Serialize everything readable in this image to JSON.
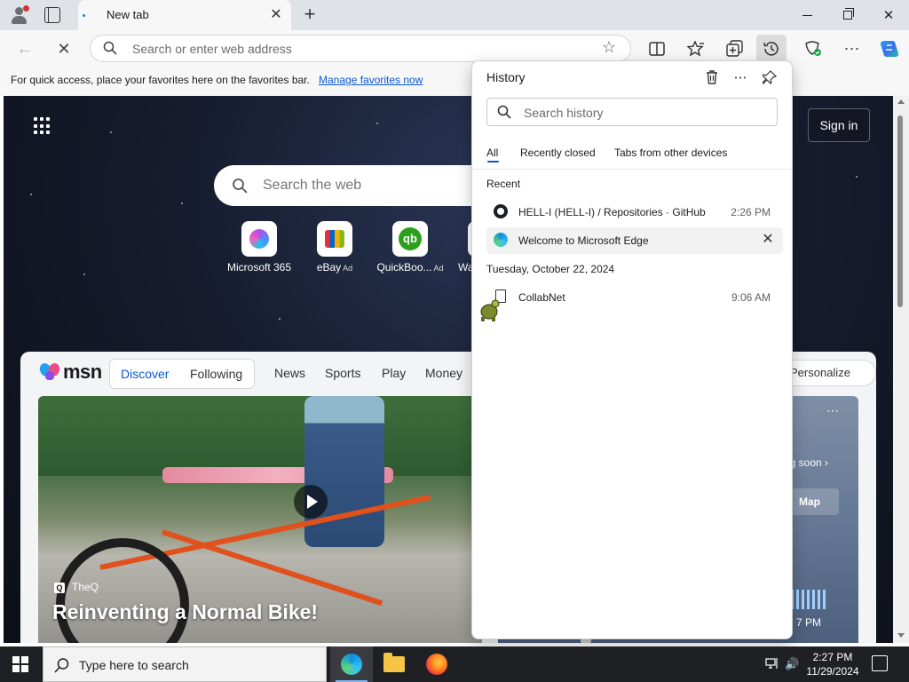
{
  "browser": {
    "tab": {
      "title": "New tab"
    },
    "address_bar": {
      "placeholder": "Search or enter web address"
    },
    "favorites_bar": {
      "message": "For quick access, place your favorites here on the favorites bar.",
      "link": "Manage favorites now"
    }
  },
  "page": {
    "sign_in": "Sign in",
    "search_placeholder": "Search the web",
    "quick_links": [
      {
        "label": "Microsoft 365",
        "ad": ""
      },
      {
        "label": "eBay",
        "ad": "Ad"
      },
      {
        "label": "QuickBoo...",
        "ad": "Ad"
      },
      {
        "label": "Wa",
        "ad": ""
      }
    ],
    "msn": {
      "logo": "msn",
      "tabs": [
        "Discover",
        "Following"
      ],
      "nav": [
        "News",
        "Sports",
        "Play",
        "Money"
      ],
      "personalize": "Personalize"
    },
    "hero": {
      "source": "TheQ",
      "source_badge": "Q",
      "headline": "Reinventing a Normal Bike!"
    },
    "weather_card": {
      "coming_soon": "ng soon",
      "map_button": "Map",
      "time": "7 PM"
    }
  },
  "history": {
    "title": "History",
    "search_placeholder": "Search history",
    "tabs": [
      "All",
      "Recently closed",
      "Tabs from other devices"
    ],
    "sections": [
      {
        "label": "Recent",
        "items": [
          {
            "title": "HELL-I (HELL-I) / Repositories · GitHub",
            "time": "2:26 PM",
            "icon": "github-icon"
          },
          {
            "title": "Welcome to Microsoft Edge",
            "time": "",
            "icon": "edge-icon"
          }
        ]
      },
      {
        "label": "Tuesday, October 22, 2024",
        "items": [
          {
            "title": "CollabNet",
            "time": "9:06 AM",
            "icon": "document-icon"
          }
        ]
      }
    ]
  },
  "taskbar": {
    "search_placeholder": "Type here to search",
    "time": "2:27 PM",
    "date": "11/29/2024"
  },
  "colors": {
    "accent": "#0b57d0",
    "tabstrip": "#dfe3e8",
    "taskbar": "#1f2024"
  }
}
